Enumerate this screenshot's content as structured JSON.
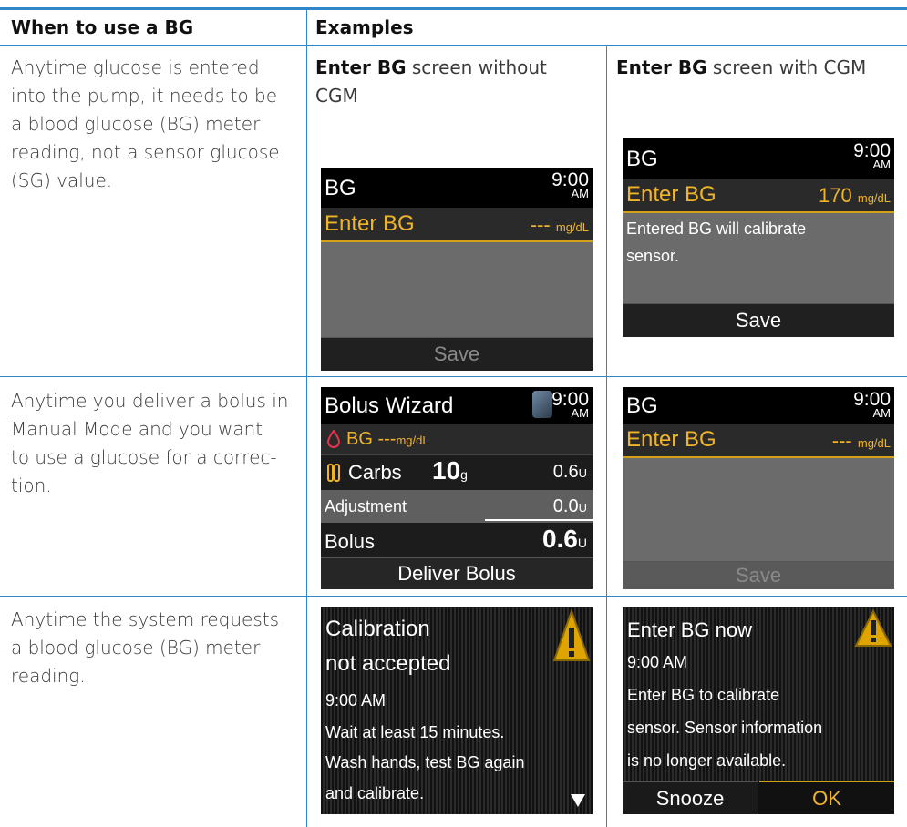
{
  "table": {
    "header": {
      "col1": "When to use a BG",
      "col2": "Examples"
    },
    "rows": [
      {
        "description": [
          "Anytime glucose is entered",
          "into the pump, it needs to be",
          "a blood glucose (BG) meter",
          "reading, not a sensor glucose",
          "(SG) value."
        ],
        "caption_a": {
          "bold": "Enter BG",
          "rest": " screen without",
          "line2": "CGM"
        },
        "caption_b": {
          "bold": "Enter BG",
          "rest": " screen with CGM"
        }
      },
      {
        "description": [
          "Anytime you deliver a bolus in",
          "Manual Mode and you want",
          "to use a glucose for a correc-",
          "tion."
        ]
      },
      {
        "description": [
          "Anytime the system requests",
          "a blood glucose (BG) meter",
          "reading."
        ]
      }
    ]
  },
  "screens": {
    "enter_bg_no_cgm": {
      "title": "BG",
      "time": "9:00",
      "ampm": "AM",
      "field": "Enter BG",
      "value": "---",
      "unit": "mg/dL",
      "footer": "Save"
    },
    "enter_bg_cgm": {
      "title": "BG",
      "time": "9:00",
      "ampm": "AM",
      "field": "Enter BG",
      "value": "170",
      "unit": "mg/dL",
      "message": [
        "Entered BG will calibrate",
        "sensor."
      ],
      "footer": "Save"
    },
    "bolus_wizard": {
      "title": "Bolus Wizard",
      "time": "9:00",
      "ampm": "AM",
      "bg_label": "BG",
      "bg_value": "---",
      "bg_unit": "mg/dL",
      "carbs_label": "Carbs",
      "carbs_value": "10",
      "carbs_unit": "g",
      "carbs_units": "0.6",
      "u": "U",
      "adjustment_label": "Adjustment",
      "adjustment_value": "0.0",
      "bolus_label": "Bolus",
      "bolus_value": "0.6",
      "footer": "Deliver Bolus"
    },
    "enter_bg_manual": {
      "title": "BG",
      "time": "9:00",
      "ampm": "AM",
      "field": "Enter BG",
      "value": "---",
      "unit": "mg/dL",
      "footer": "Save"
    },
    "calibration_alert": {
      "lines": [
        "Calibration",
        "not accepted",
        "9:00 AM",
        "Wait at least 15 minutes.",
        "Wash hands, test BG again",
        "and calibrate."
      ]
    },
    "enter_bg_now_alert": {
      "lines": [
        "Enter BG now",
        "9:00 AM",
        "Enter BG to calibrate",
        "sensor. Sensor information",
        "is no longer available."
      ],
      "snooze": "Snooze",
      "ok": "OK"
    }
  },
  "colors": {
    "rule": "#2f86c8",
    "amber": "#f0b429",
    "drop": "#e8334a"
  }
}
